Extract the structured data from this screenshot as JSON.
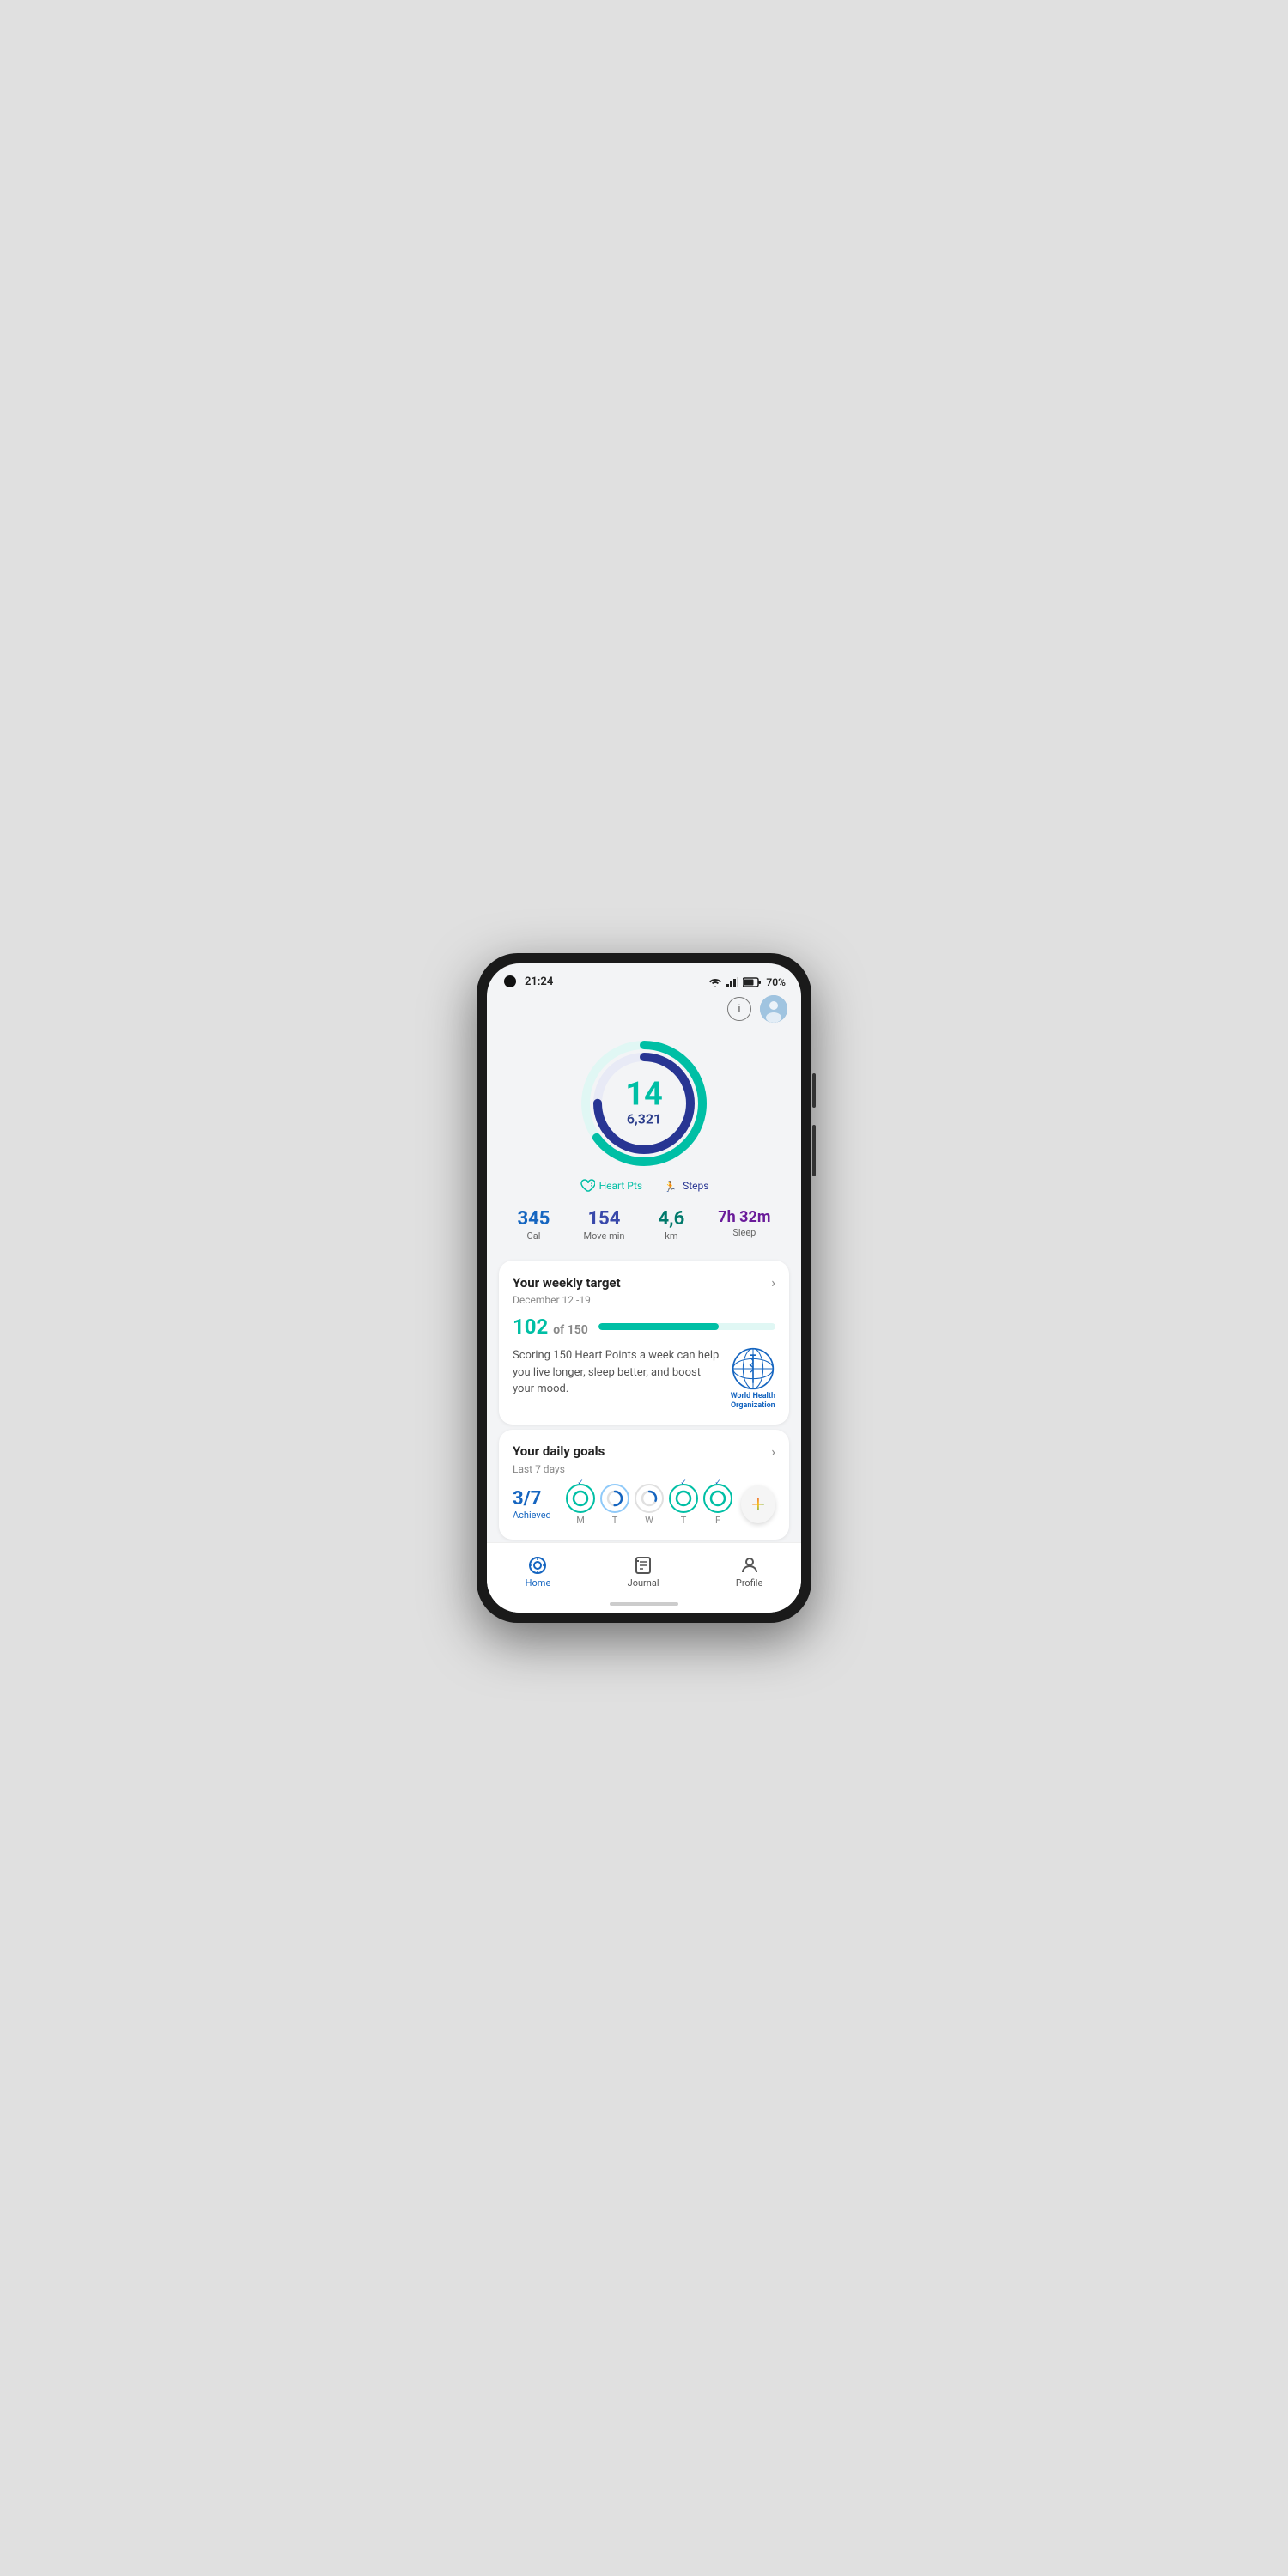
{
  "status": {
    "time": "21:24",
    "battery": "70%"
  },
  "header": {
    "info_label": "ⓘ",
    "avatar_alt": "user avatar"
  },
  "ring": {
    "heart_pts": "14",
    "steps": "6,321",
    "heart_pts_label": "Heart Pts",
    "steps_label": "Steps",
    "heart_progress": 0.65,
    "steps_progress": 0.75
  },
  "stats": [
    {
      "value": "345",
      "label": "Cal",
      "color": "stat-blue"
    },
    {
      "value": "154",
      "label": "Move min",
      "color": "stat-indigo"
    },
    {
      "value": "4,6",
      "label": "km",
      "color": "stat-teal"
    },
    {
      "value": "7h 32m",
      "label": "Sleep",
      "color": "stat-purple"
    }
  ],
  "weekly_target": {
    "title": "Your weekly target",
    "date_range": "December 12 -19",
    "current": "102",
    "total": "150",
    "progress": 0.68,
    "description": "Scoring 150 Heart Points a week can help you live longer, sleep better, and boost your mood.",
    "who_name": "World Health\nOrganization"
  },
  "daily_goals": {
    "title": "Your daily goals",
    "subtitle": "Last 7 days",
    "achieved": "3/7",
    "achieved_label": "Achieved",
    "days": [
      {
        "label": "M",
        "state": "achieved",
        "check": true
      },
      {
        "label": "T",
        "state": "partial",
        "check": false
      },
      {
        "label": "W",
        "state": "partial",
        "check": false
      },
      {
        "label": "T",
        "state": "achieved",
        "check": true
      },
      {
        "label": "F",
        "state": "achieved",
        "check": true
      }
    ]
  },
  "nav": {
    "items": [
      {
        "id": "home",
        "label": "Home",
        "active": true
      },
      {
        "id": "journal",
        "label": "Journal",
        "active": false
      },
      {
        "id": "profile",
        "label": "Profile",
        "active": false
      }
    ]
  }
}
